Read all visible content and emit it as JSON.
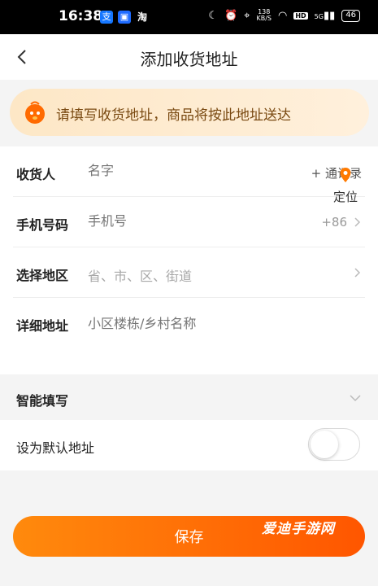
{
  "status_bar": {
    "time": "16:38",
    "apps": [
      "alipay-icon",
      "messenger-icon",
      "taobao-icon"
    ],
    "app3_text": "淘",
    "net_speed_value": "138",
    "net_speed_unit": "KB/S",
    "hd_label": "HD",
    "signal_label": "5G",
    "battery": "46"
  },
  "nav": {
    "title": "添加收货地址"
  },
  "tip": {
    "text": "请填写收货地址，商品将按此地址送达"
  },
  "form": {
    "recipient": {
      "label": "收货人",
      "placeholder": "名字",
      "action": "+ 通讯录"
    },
    "phone": {
      "label": "手机号码",
      "placeholder": "手机号",
      "country_code": "+86"
    },
    "region": {
      "label": "选择地区",
      "placeholder": "省、市、区、街道"
    },
    "detail": {
      "label": "详细地址",
      "placeholder": "小区楼栋/乡村名称",
      "locate_label": "定位"
    }
  },
  "smart_fill": {
    "label": "智能填写"
  },
  "default_address": {
    "label": "设为默认地址",
    "enabled": false
  },
  "save_label": "保存",
  "watermark": "爱迪手游网",
  "colors": {
    "accent_start": "#ff8a0d",
    "accent_end": "#ff5600",
    "tip_bg": "#fde7c6",
    "tip_text": "#7a4a12"
  }
}
